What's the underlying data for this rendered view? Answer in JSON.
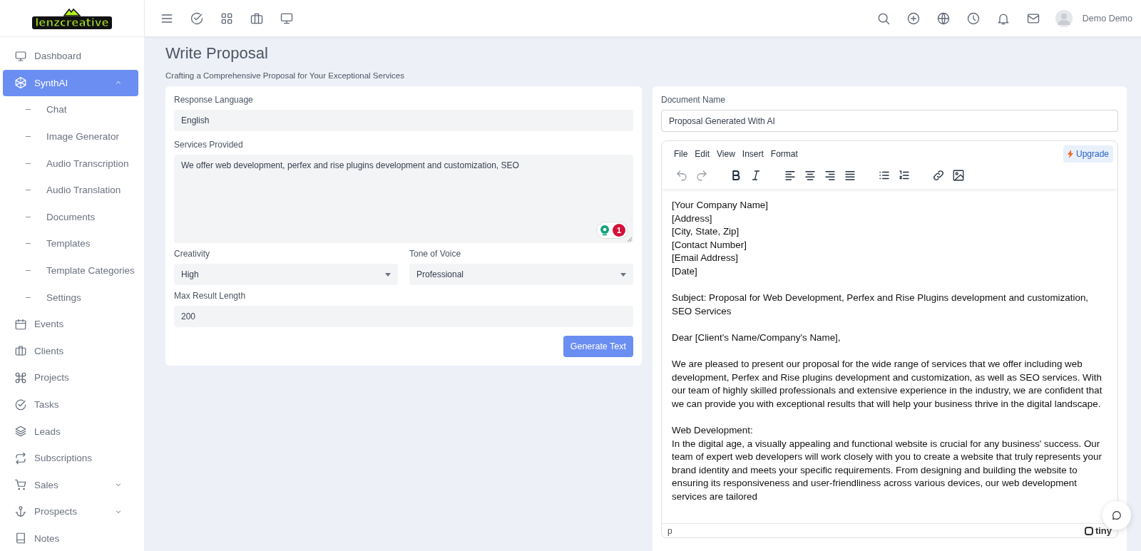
{
  "header": {
    "logo": "lenzcreative",
    "user": {
      "name": "Demo Demo"
    }
  },
  "sidebar": {
    "items": [
      {
        "label": "Dashboard",
        "selected": false
      },
      {
        "label": "SynthAI",
        "selected": true,
        "expanded": true,
        "children": [
          {
            "label": "Chat",
            "selected": false
          },
          {
            "label": "Image Generator",
            "selected": false
          },
          {
            "label": "Audio Transcription",
            "selected": false
          },
          {
            "label": "Audio Translation",
            "selected": false
          },
          {
            "label": "Documents",
            "selected": false
          },
          {
            "label": "Templates",
            "selected": false
          },
          {
            "label": "Template Categories",
            "selected": false
          },
          {
            "label": "Settings",
            "selected": false
          }
        ]
      },
      {
        "label": "Events",
        "selected": false
      },
      {
        "label": "Clients",
        "selected": false
      },
      {
        "label": "Projects",
        "selected": false
      },
      {
        "label": "Tasks",
        "selected": false
      },
      {
        "label": "Leads",
        "selected": false
      },
      {
        "label": "Subscriptions",
        "selected": false
      },
      {
        "label": "Sales",
        "selected": false,
        "expanded": false
      },
      {
        "label": "Prospects",
        "selected": false,
        "expanded": false
      },
      {
        "label": "Notes",
        "selected": false
      }
    ]
  },
  "page": {
    "title": "Write Proposal",
    "subtitle": "Crafting a Comprehensive Proposal for Your Exceptional Services"
  },
  "form": {
    "response_language": {
      "label": "Response Language",
      "value": "English"
    },
    "services": {
      "label": "Services Provided",
      "value": "We offer web development, perfex and rise plugins development and customization, SEO",
      "badge": "1"
    },
    "creativity": {
      "label": "Creativity",
      "value": "High"
    },
    "tone": {
      "label": "Tone of Voice",
      "value": "Professional"
    },
    "max_length": {
      "label": "Max Result Length",
      "value": "200"
    },
    "submit": "Generate Text"
  },
  "document": {
    "name_label": "Document Name",
    "name_value": "Proposal Generated With AI",
    "menu": [
      "File",
      "Edit",
      "View",
      "Insert",
      "Format"
    ],
    "upgrade": "Upgrade",
    "content": [
      {
        "lines": [
          "[Your Company Name]",
          "[Address]",
          "[City, State, Zip]",
          "[Contact Number]",
          "[Email Address]",
          "[Date]"
        ]
      },
      {
        "lines": [
          "Subject: Proposal for Web Development, Perfex and Rise Plugins development and customization, SEO Services"
        ]
      },
      {
        "lines": [
          "Dear [Client's Name/Company's Name],"
        ]
      },
      {
        "lines": [
          "We are pleased to present our proposal for the wide range of services that we offer including web development, Perfex and Rise plugins development and customization, as well as SEO services. With our team of highly skilled professionals and extensive experience in the industry, we are confident that we can provide you with exceptional results that will help your business thrive in the digital landscape."
        ]
      },
      {
        "lines": [
          "Web Development:",
          "In the digital age, a visually appealing and functional website is crucial for any business' success. Our team of expert web developers will work closely with you to create a website that truly represents your brand identity and meets your specific requirements. From designing and building the website to ensuring its responsiveness and user-friendliness across various devices, our web development services are tailored"
        ]
      }
    ],
    "status_path": "p",
    "brand": "tiny"
  }
}
